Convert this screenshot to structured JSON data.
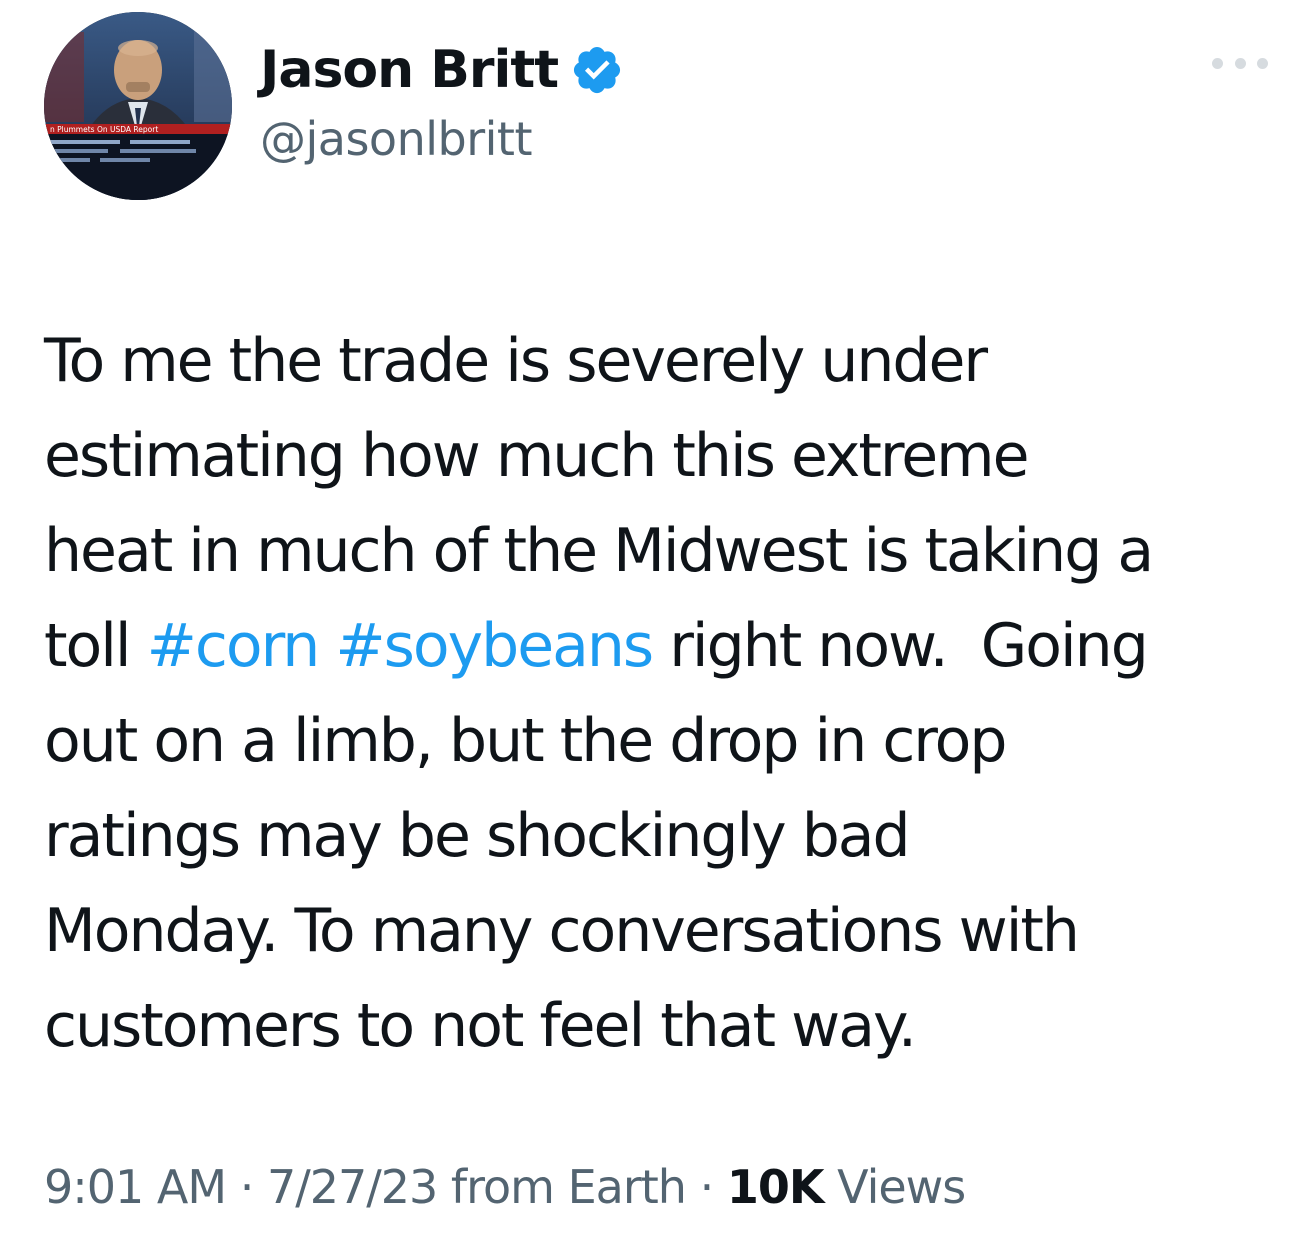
{
  "author": {
    "display_name": "Jason Britt",
    "handle": "@jasonlbritt",
    "verified_icon": "verified-badge-icon",
    "avatar_caption": "n Plummets On USDA Report"
  },
  "tweet": {
    "lines": [
      {
        "text": "To me the trade is severely under"
      },
      {
        "text": "estimating how much this extreme"
      },
      {
        "text": "heat in much of the Midwest is taking a"
      },
      {
        "text": "toll ",
        "hashtag1": "#corn",
        "sep": " ",
        "hashtag2": "#soybeans",
        "rest": " right now.  Going"
      },
      {
        "text": "out on a limb, but the drop in crop"
      },
      {
        "text": "ratings may be shockingly bad"
      },
      {
        "text": "Monday. To many conversations with"
      },
      {
        "text": "customers to not feel that way."
      }
    ]
  },
  "meta": {
    "time": "9:01 AM",
    "dot1": " · ",
    "date": "7/27/23",
    "source": " from Earth",
    "dot2": " · ",
    "views_count": "10K",
    "views_label": " Views"
  },
  "colors": {
    "text": "#0f1419",
    "secondary": "#536471",
    "link": "#1d9bf0",
    "verified": "#1d9bf0"
  }
}
